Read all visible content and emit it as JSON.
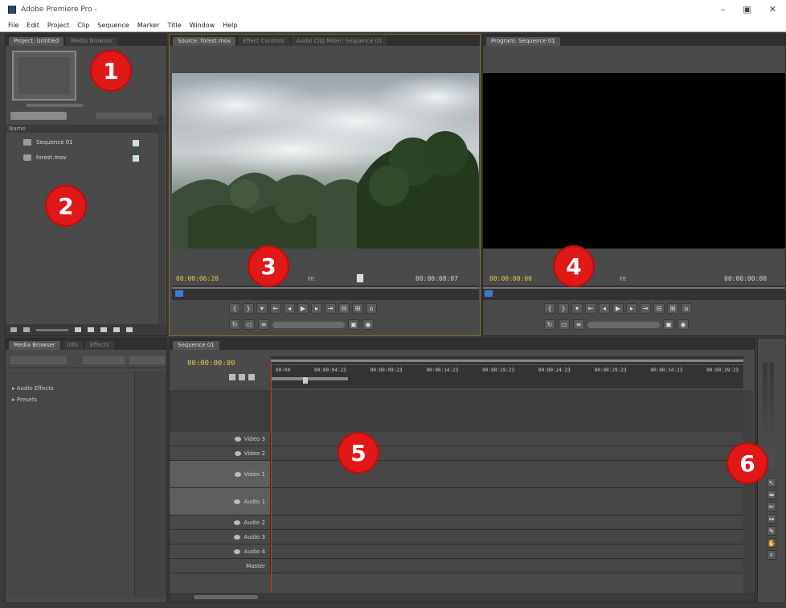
{
  "window": {
    "title": "Adobe Premiere Pro -",
    "buttons": [
      "–",
      "▣",
      "✕"
    ]
  },
  "menu": [
    "File",
    "Edit",
    "Project",
    "Clip",
    "Sequence",
    "Marker",
    "Title",
    "Window",
    "Help"
  ],
  "project_panel": {
    "tabs": [
      "Project: Untitled",
      "Media Browser"
    ],
    "items": [
      {
        "name": "Sequence 01",
        "icon": "sequence-icon"
      },
      {
        "name": "forest.mov",
        "icon": "clip-icon"
      }
    ],
    "column": "Name"
  },
  "source_monitor": {
    "tabs": [
      "Source: forest.mov",
      "Effect Controls",
      "Audio Clip Mixer: Sequence 01"
    ],
    "timecode_in": "00:00:06:20",
    "zoom": "Fit",
    "timecode_out": "00:00:08:07"
  },
  "program_monitor": {
    "tabs": [
      "Program: Sequence 01"
    ],
    "timecode_in": "00:00:00:00",
    "zoom": "Fit",
    "timecode_out": "00:00:00:00"
  },
  "effects_panel": {
    "tabs": [
      "Media Browser",
      "Info",
      "Effects"
    ],
    "items": [
      "Audio Effects",
      "Presets"
    ]
  },
  "timeline": {
    "tabs": [
      "Sequence 01"
    ],
    "timecode": "00:00:00:00",
    "ruler": [
      "00:00",
      "00:00:04:23",
      "00:00:09:23",
      "00:00:14:23",
      "00:00:19:23",
      "00:00:24:23",
      "00:00:29:23",
      "00:00:34:23",
      "00:00:39:23"
    ],
    "video_tracks": [
      "Video 3",
      "Video 2",
      "Video 1"
    ],
    "audio_tracks": [
      "Audio 1",
      "Audio 2",
      "Audio 3",
      "Audio 4",
      "Master"
    ]
  },
  "callouts": [
    "1",
    "2",
    "3",
    "4",
    "5",
    "6"
  ],
  "colors": {
    "callout": "#e01818",
    "timecode": "#e8c54a",
    "panel": "#4a4a4a"
  }
}
